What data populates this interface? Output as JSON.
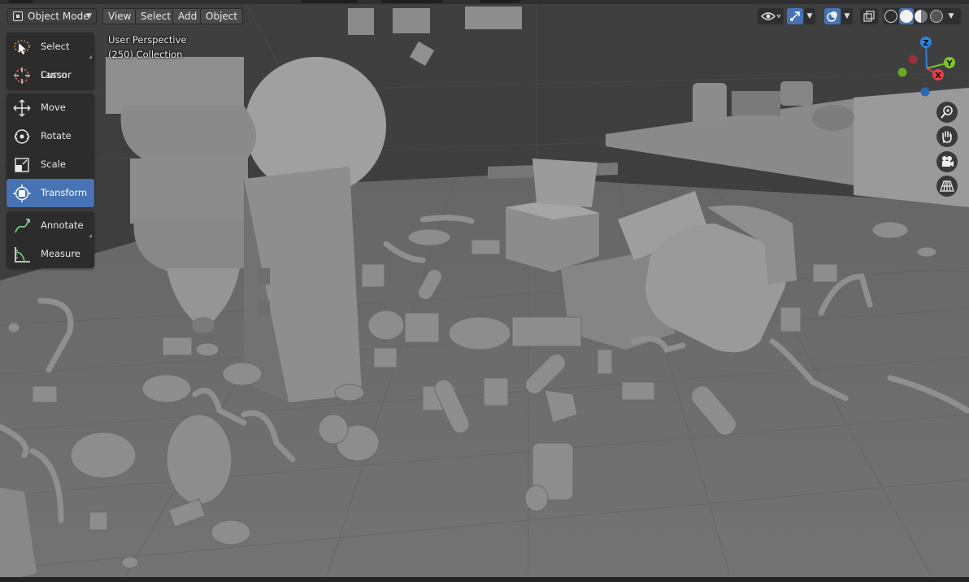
{
  "header": {
    "mode": {
      "label": "Object Mode",
      "icon": "object-mode-icon"
    },
    "menus": [
      "View",
      "Select",
      "Add",
      "Object"
    ],
    "right_icons": [
      "visibility-eye-icon",
      "gizmo-toggle-icon",
      "overlays-icon",
      "xray-icon",
      "wireframe-shading-icon",
      "solid-shading-icon",
      "material-shading-icon",
      "rendered-shading-icon"
    ]
  },
  "overlay": {
    "perspective": "User Perspective",
    "collection": "(250) Collection"
  },
  "toolbar": {
    "groups": [
      [
        {
          "label": "Select Lasso",
          "icon": "select-lasso-icon",
          "active": false
        },
        {
          "label": "Cursor",
          "icon": "cursor-icon",
          "active": false
        }
      ],
      [
        {
          "label": "Move",
          "icon": "move-icon",
          "active": false
        },
        {
          "label": "Rotate",
          "icon": "rotate-icon",
          "active": false
        },
        {
          "label": "Scale",
          "icon": "scale-icon",
          "active": false
        },
        {
          "label": "Transform",
          "icon": "transform-icon",
          "active": true
        }
      ],
      [
        {
          "label": "Annotate",
          "icon": "annotate-icon",
          "active": false
        },
        {
          "label": "Measure",
          "icon": "measure-icon",
          "active": false
        }
      ]
    ]
  },
  "gizmo": {
    "axes": {
      "x": "X",
      "y": "Y",
      "z": "Z"
    },
    "colors": {
      "x": "#e5414d",
      "y": "#7fc42b",
      "z": "#2f83e1"
    }
  },
  "nav_buttons": [
    "zoom-icon",
    "pan-hand-icon",
    "camera-view-icon",
    "perspective-grid-icon"
  ],
  "colors": {
    "accent": "#4772b3",
    "floor": "#6c6c6c",
    "object": "#8e8e8e"
  }
}
